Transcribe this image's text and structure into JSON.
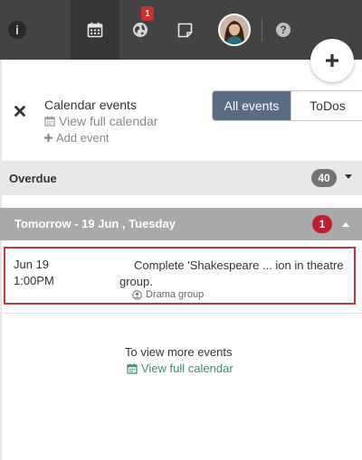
{
  "topbar": {
    "info_icon_char": "i",
    "notification_count": "1",
    "help_icon_char": "?"
  },
  "panel": {
    "title": "Calendar events",
    "view_full_calendar": "View full calendar",
    "add_event": "Add event",
    "filter": {
      "all_events": "All events",
      "todos": "ToDos",
      "selected": "All events"
    }
  },
  "sections": {
    "overdue": {
      "label": "Overdue",
      "count": "40"
    },
    "tomorrow": {
      "label": "Tomorrow - 19 Jun , Tuesday",
      "count": "1"
    }
  },
  "events": [
    {
      "date": "Jun 19",
      "time": "1:00PM",
      "title": "Complete 'Shakespeare ... ion in theatre group.",
      "group": "Drama group"
    }
  ],
  "footer": {
    "more_text": "To view more events",
    "view_full_calendar": "View full calendar"
  },
  "colors": {
    "topbar": "#434343",
    "segment_active": "#5a6b82",
    "badge_red": "#bf1e2e",
    "link_green": "#3a8f6e"
  }
}
